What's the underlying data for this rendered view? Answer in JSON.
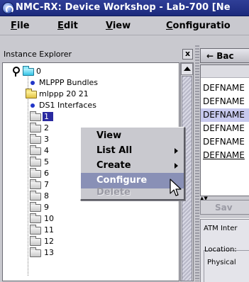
{
  "window": {
    "title": "NMC-RX: Device Workshop - Lab-700 [Ne"
  },
  "menubar": {
    "items": [
      {
        "label": "File",
        "mnemonic": "F"
      },
      {
        "label": "Edit",
        "mnemonic": "E"
      },
      {
        "label": "View",
        "mnemonic": "V"
      },
      {
        "label": "Configuratio",
        "mnemonic": "C"
      }
    ]
  },
  "explorer": {
    "title": "Instance Explorer",
    "close_glyph": "x",
    "tree": {
      "root_label": "0",
      "children": [
        {
          "label": "MLPPP Bundles",
          "icon": "bullet-icon"
        },
        {
          "label": "mlppp 20 21",
          "icon": "yellow-folder-icon"
        },
        {
          "label": "DS1 Interfaces",
          "icon": "bullet-icon"
        }
      ],
      "ds1_items": [
        "1",
        "2",
        "3",
        "4",
        "5",
        "6",
        "7",
        "8",
        "9",
        "10",
        "11",
        "12",
        "13"
      ],
      "selected": "1"
    }
  },
  "context_menu": {
    "items": [
      {
        "label": "View",
        "submenu": false,
        "state": "normal"
      },
      {
        "label": "List All",
        "submenu": true,
        "state": "normal"
      },
      {
        "label": "Create",
        "submenu": true,
        "state": "normal"
      },
      {
        "label": "Configure",
        "submenu": false,
        "state": "highlighted"
      },
      {
        "label": "Delete",
        "submenu": false,
        "state": "disabled"
      }
    ]
  },
  "right_panel": {
    "back_label": "← Bac",
    "rows": [
      "DEFNAME",
      "DEFNAME",
      "DEFNAME",
      "DEFNAME",
      "DEFNAME",
      "DEFNAME"
    ],
    "selected_row": 2,
    "save_label": "Sav",
    "tab_label": "ATM Inter",
    "group_lines": [
      "Location:",
      "Physical"
    ]
  },
  "colors": {
    "title_bar": "#253389",
    "selection": "#2a2aa0",
    "menu_highlight": "#8990b6",
    "list_selection": "#c7c9ee"
  }
}
